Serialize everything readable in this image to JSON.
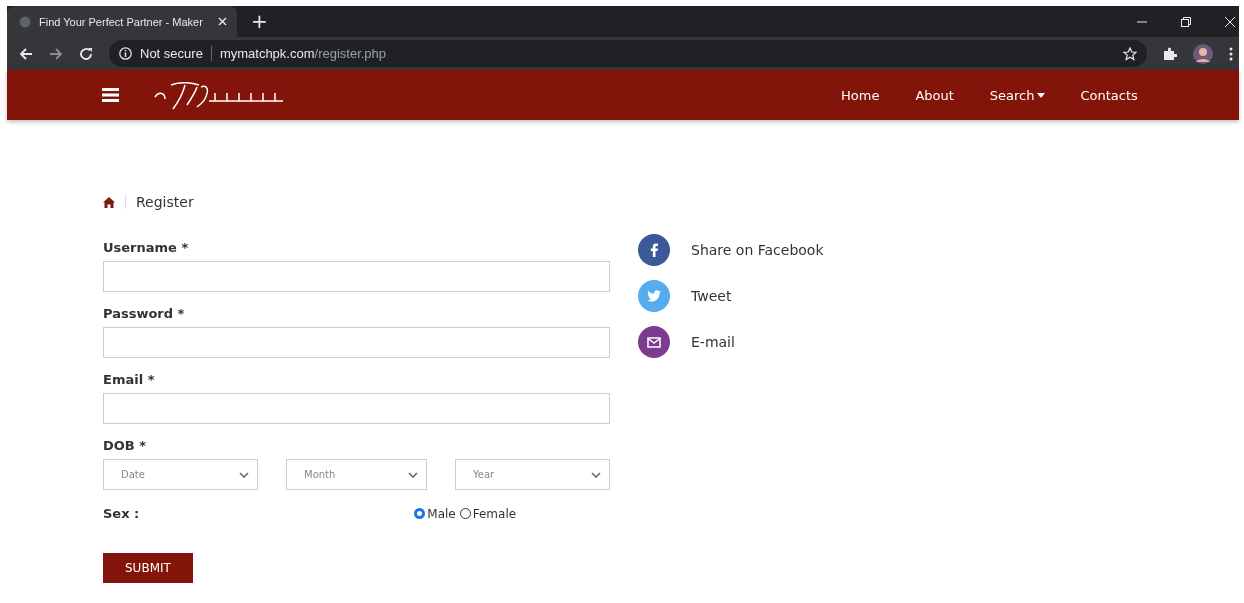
{
  "browser": {
    "tab_title": "Find Your Perfect Partner - Maker",
    "new_tab": "+",
    "security": "Not secure",
    "url_host": "mymatchpk.com",
    "url_path": "/register.php"
  },
  "nav": {
    "items": [
      {
        "label": "Home",
        "dropdown": false
      },
      {
        "label": "About",
        "dropdown": false
      },
      {
        "label": "Search",
        "dropdown": true
      },
      {
        "label": "Contacts",
        "dropdown": false
      }
    ]
  },
  "breadcrumb": {
    "current": "Register"
  },
  "form": {
    "fields": [
      {
        "label": "Username *"
      },
      {
        "label": "Password *"
      },
      {
        "label": "Email *"
      }
    ],
    "dob": {
      "label": "DOB *",
      "selects": [
        {
          "placeholder": "Date"
        },
        {
          "placeholder": "Month"
        },
        {
          "placeholder": "Year"
        }
      ]
    },
    "sex": {
      "label": "Sex :",
      "options": [
        {
          "label": "Male",
          "selected": true
        },
        {
          "label": "Female",
          "selected": false
        }
      ]
    },
    "submit": "SUBMIT"
  },
  "share": [
    {
      "kind": "facebook",
      "label": "Share on Facebook",
      "color": "#3b5998"
    },
    {
      "kind": "twitter",
      "label": "Tweet",
      "color": "#55acee"
    },
    {
      "kind": "email",
      "label": "E-mail",
      "color": "#7d3b8f"
    }
  ]
}
